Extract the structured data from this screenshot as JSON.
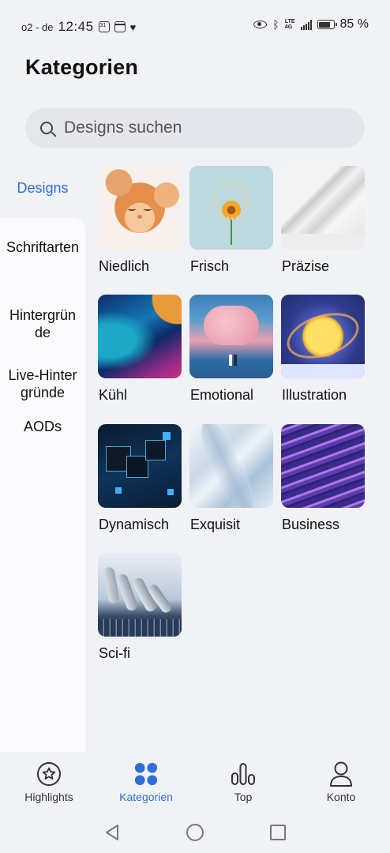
{
  "status": {
    "carrier": "o2 - de",
    "time": "12:45",
    "battery": "85 %"
  },
  "header": {
    "title": "Kategorien"
  },
  "search": {
    "placeholder": "Designs suchen"
  },
  "sidebar": {
    "items": [
      {
        "label": "Designs",
        "selected": true
      },
      {
        "label": "Schriftarten",
        "selected": false
      },
      {
        "label": "Hintergrün\nde",
        "selected": false
      },
      {
        "label": "Live-Hinter\ngründe",
        "selected": false
      },
      {
        "label": "AODs",
        "selected": false
      }
    ]
  },
  "categories": [
    {
      "label": "Niedlich",
      "image": "kitten"
    },
    {
      "label": "Frisch",
      "image": "flower"
    },
    {
      "label": "Präzise",
      "image": "shadow"
    },
    {
      "label": "Kühl",
      "image": "gradient"
    },
    {
      "label": "Emotional",
      "image": "cloud-couple"
    },
    {
      "label": "Illustration",
      "image": "planet"
    },
    {
      "label": "Dynamisch",
      "image": "cubes"
    },
    {
      "label": "Exquisit",
      "image": "feather"
    },
    {
      "label": "Business",
      "image": "waves"
    },
    {
      "label": "Sci-fi",
      "image": "robot-hand"
    }
  ],
  "bottom_nav": [
    {
      "label": "Highlights",
      "icon": "star-icon",
      "active": false
    },
    {
      "label": "Kategorien",
      "icon": "grid-icon",
      "active": true
    },
    {
      "label": "Top",
      "icon": "bar-chart-icon",
      "active": false
    },
    {
      "label": "Konto",
      "icon": "person-icon",
      "active": false
    }
  ],
  "colors": {
    "accent": "#2f6fd6",
    "background": "#f1f2f6"
  }
}
